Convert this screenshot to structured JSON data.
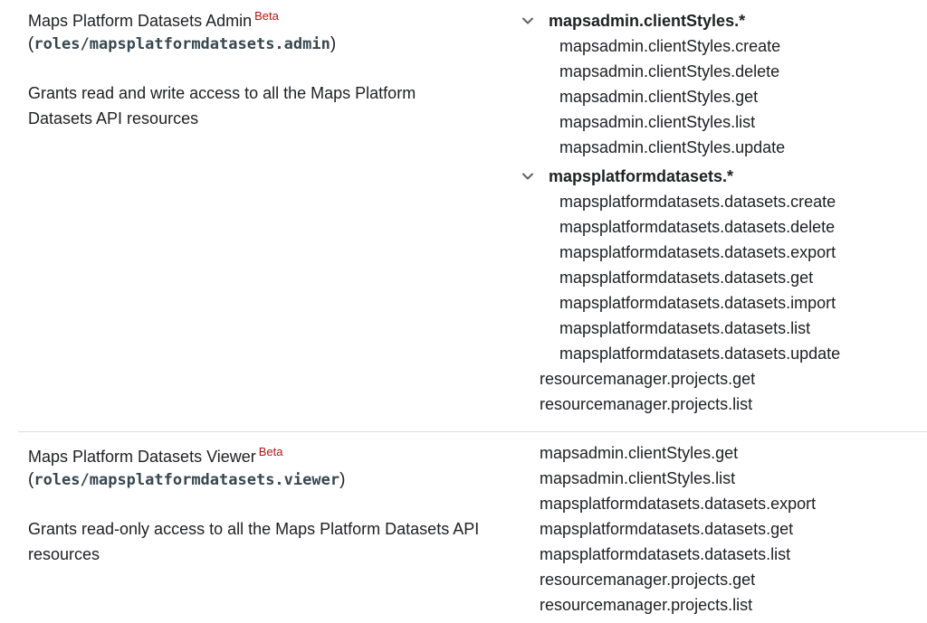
{
  "roles": [
    {
      "name": "Maps Platform Datasets Admin",
      "badge": "Beta",
      "id_prefix": "(",
      "id": "roles/mapsplatformdatasets.admin",
      "id_suffix": ")",
      "description": "Grants read and write access to all the Maps Platform Datasets API resources",
      "groups": [
        {
          "name": "mapsadmin.clientStyles.*",
          "items": [
            "mapsadmin.clientStyles.create",
            "mapsadmin.clientStyles.delete",
            "mapsadmin.clientStyles.get",
            "mapsadmin.clientStyles.list",
            "mapsadmin.clientStyles.update"
          ]
        },
        {
          "name": "mapsplatformdatasets.*",
          "items": [
            "mapsplatformdatasets.datasets.create",
            "mapsplatformdatasets.datasets.delete",
            "mapsplatformdatasets.datasets.export",
            "mapsplatformdatasets.datasets.get",
            "mapsplatformdatasets.datasets.import",
            "mapsplatformdatasets.datasets.list",
            "mapsplatformdatasets.datasets.update"
          ]
        }
      ],
      "extra": [
        "resourcemanager.projects.get",
        "resourcemanager.projects.list"
      ]
    },
    {
      "name": "Maps Platform Datasets Viewer",
      "badge": "Beta",
      "id_prefix": "(",
      "id": "roles/mapsplatformdatasets.viewer",
      "id_suffix": ")",
      "description": "Grants read-only access to all the Maps Platform Datasets API resources",
      "permissions": [
        "mapsadmin.clientStyles.get",
        "mapsadmin.clientStyles.list",
        "mapsplatformdatasets.datasets.export",
        "mapsplatformdatasets.datasets.get",
        "mapsplatformdatasets.datasets.list",
        "resourcemanager.projects.get",
        "resourcemanager.projects.list"
      ]
    }
  ]
}
